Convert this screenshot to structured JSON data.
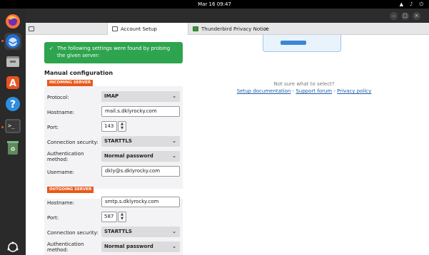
{
  "topbar": {
    "datetime": "Mar 16  09:47"
  },
  "tabs": [
    {
      "label": ""
    },
    {
      "label": "Account Setup"
    },
    {
      "label": "Thunderbird Privacy Notice"
    }
  ],
  "banner": {
    "text": "The following settings were found by probing the given server:"
  },
  "manual": {
    "title": "Manual configuration",
    "incoming": {
      "tag": "INCOMING SERVER",
      "protocol_label": "Protocol:",
      "protocol": "IMAP",
      "hostname_label": "Hostname:",
      "hostname": "mail.s.dklyrocky.com",
      "port_label": "Port:",
      "port": "143",
      "security_label": "Connection security:",
      "security": "STARTTLS",
      "auth_label": "Authentication method:",
      "auth": "Normal password",
      "username_label": "Username:",
      "username": "dkly@s.dklyrocky.com"
    },
    "outgoing": {
      "tag": "OUTGOING SERVER",
      "hostname_label": "Hostname:",
      "hostname": "smtp.s.dklyrocky.com",
      "port_label": "Port:",
      "port": "587",
      "security_label": "Connection security:",
      "security": "STARTTLS",
      "auth_label": "Authentication method:",
      "auth": "Normal password"
    }
  },
  "help": {
    "question": "Not sure what to select?",
    "link1": "Setup documentation",
    "sep1": " - ",
    "link2": "Support forum",
    "sep2": " - ",
    "link3": "Privacy policy"
  },
  "colors": {
    "accent": "#e95420",
    "success": "#2ea44f",
    "link": "#1a5ea8"
  }
}
